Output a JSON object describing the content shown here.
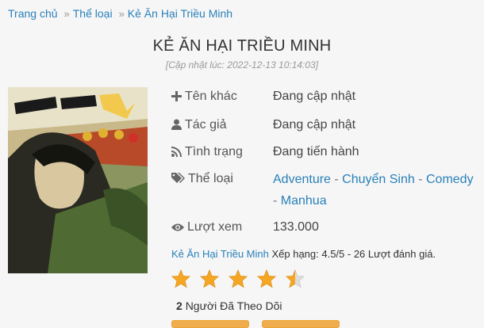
{
  "breadcrumb": {
    "home": "Trang chủ",
    "category": "Thể loại",
    "current": "Kẻ Ăn Hại Triều Minh",
    "separator": "»"
  },
  "title": "KẺ ĂN HẠI TRIỀU MINH",
  "updated": "[Cập nhật lúc: 2022-12-13 10:14:03]",
  "info": {
    "other_name_label": "Tên khác",
    "other_name": "Đang cập nhật",
    "author_label": "Tác giả",
    "author": "Đang cập nhật",
    "status_label": "Tình trạng",
    "status": "Đang tiến hành",
    "genres_label": "Thể loại",
    "genres": [
      "Adventure",
      "Chuyển Sinh",
      "Comedy",
      "Manhua"
    ],
    "genre_separator": " - ",
    "views_label": "Lượt xem",
    "views": "133.000"
  },
  "rating": {
    "name": "Kẻ Ăn Hại Triều Minh",
    "text": "Xếp hạng: 4.5/5 - 26 Lượt đánh giá.",
    "value": 4.5,
    "max": 5
  },
  "followers": {
    "count": "2",
    "text": "Người Đã Theo Dõi"
  },
  "colors": {
    "link": "#2980b9",
    "star": "#f5a623",
    "button": "#f0ad4e"
  }
}
